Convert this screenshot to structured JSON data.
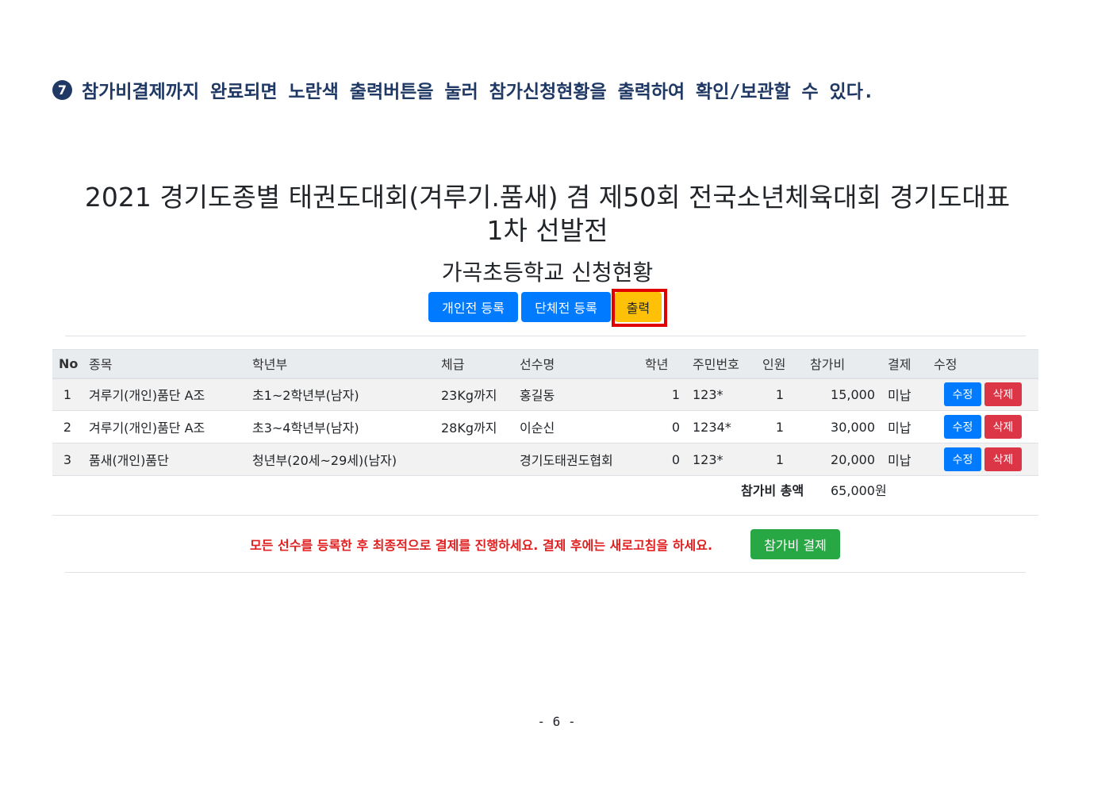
{
  "instruction": {
    "number": "7",
    "text": "참가비결제까지 완료되면 노란색 출력버튼을 눌러 참가신청현황을 출력하여 확인/보관할 수 있다."
  },
  "title_line1": "2021 경기도종별 태권도대회(겨루기.품새) 겸 제50회 전국소년체육대회 경기도대표",
  "title_line2": "1차 선발전",
  "subtitle": "가곡초등학교 신청현황",
  "buttons": {
    "individual": "개인전 등록",
    "team": "단체전 등록",
    "print": "출력"
  },
  "table": {
    "headers": [
      "No",
      "종목",
      "학년부",
      "체급",
      "선수명",
      "학년",
      "주민번호",
      "인원",
      "참가비",
      "결제",
      "수정"
    ],
    "rows": [
      {
        "no": "1",
        "event": "겨루기(개인)품단 A조",
        "division": "초1~2학년부(남자)",
        "weight": "23Kg까지",
        "name": "홍길동",
        "grade": "1",
        "id": "123*",
        "count": "1",
        "fee": "15,000",
        "paid": "미납",
        "edit": "수정",
        "delete": "삭제"
      },
      {
        "no": "2",
        "event": "겨루기(개인)품단 A조",
        "division": "초3~4학년부(남자)",
        "weight": "28Kg까지",
        "name": "이순신",
        "grade": "0",
        "id": "1234*",
        "count": "1",
        "fee": "30,000",
        "paid": "미납",
        "edit": "수정",
        "delete": "삭제"
      },
      {
        "no": "3",
        "event": "품새(개인)품단",
        "division": "청년부(20세~29세)(남자)",
        "weight": "",
        "name": "경기도태권도협회",
        "grade": "0",
        "id": "123*",
        "count": "1",
        "fee": "20,000",
        "paid": "미납",
        "edit": "수정",
        "delete": "삭제"
      }
    ]
  },
  "total": {
    "label": "참가비 총액",
    "value": "65,000원"
  },
  "notice": "모든 선수를 등록한 후 최종적으로 결제를 진행하세요. 결제 후에는 새로고침을 하세요.",
  "pay_button": "참가비 결제",
  "page_number": "- 6 -",
  "colors": {
    "primary": "#007bff",
    "warning": "#ffc107",
    "success": "#28a745",
    "danger": "#dc3545",
    "notice": "#e02020",
    "instruction": "#1f3864"
  }
}
